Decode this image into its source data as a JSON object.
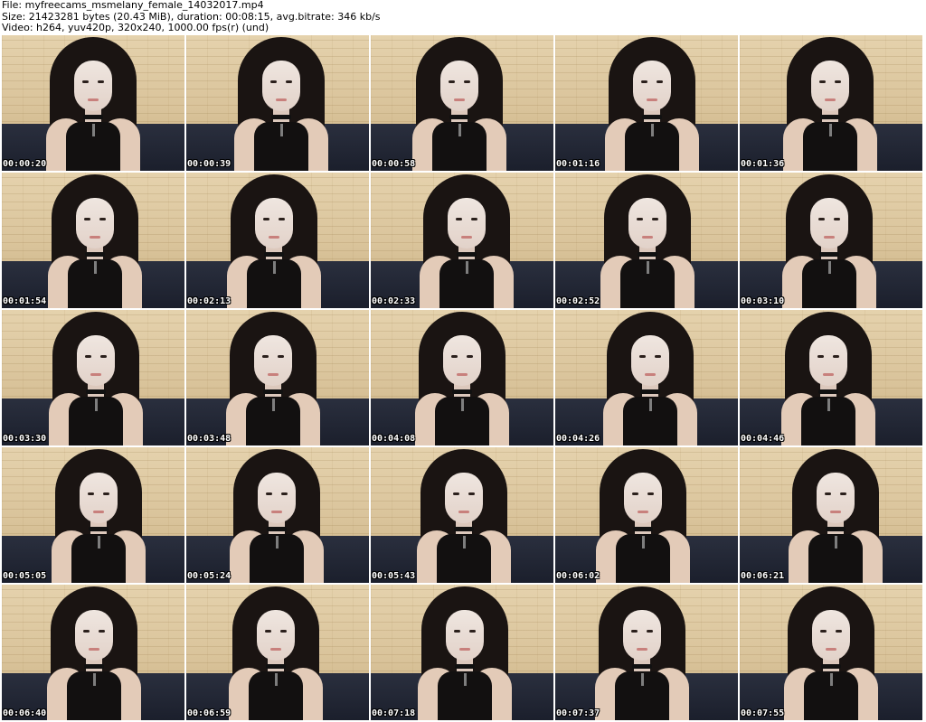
{
  "header": {
    "line1": "File: myfreecams_msmelany_female_14032017.mp4",
    "line2": "Size: 21423281 bytes (20.43 MiB), duration: 00:08:15, avg.bitrate: 346 kb/s",
    "line3": "Video: h264, yuv420p, 320x240, 1000.00 fps(r) (und)"
  },
  "thumbnails": [
    {
      "timestamp": "00:00:20"
    },
    {
      "timestamp": "00:00:39"
    },
    {
      "timestamp": "00:00:58"
    },
    {
      "timestamp": "00:01:16"
    },
    {
      "timestamp": "00:01:36"
    },
    {
      "timestamp": "00:01:54"
    },
    {
      "timestamp": "00:02:13"
    },
    {
      "timestamp": "00:02:33"
    },
    {
      "timestamp": "00:02:52"
    },
    {
      "timestamp": "00:03:10"
    },
    {
      "timestamp": "00:03:30"
    },
    {
      "timestamp": "00:03:48"
    },
    {
      "timestamp": "00:04:08"
    },
    {
      "timestamp": "00:04:26"
    },
    {
      "timestamp": "00:04:46"
    },
    {
      "timestamp": "00:05:05"
    },
    {
      "timestamp": "00:05:24"
    },
    {
      "timestamp": "00:05:43"
    },
    {
      "timestamp": "00:06:02"
    },
    {
      "timestamp": "00:06:21"
    },
    {
      "timestamp": "00:06:40"
    },
    {
      "timestamp": "00:06:59"
    },
    {
      "timestamp": "00:07:18"
    },
    {
      "timestamp": "00:07:37"
    },
    {
      "timestamp": "00:07:55"
    }
  ]
}
